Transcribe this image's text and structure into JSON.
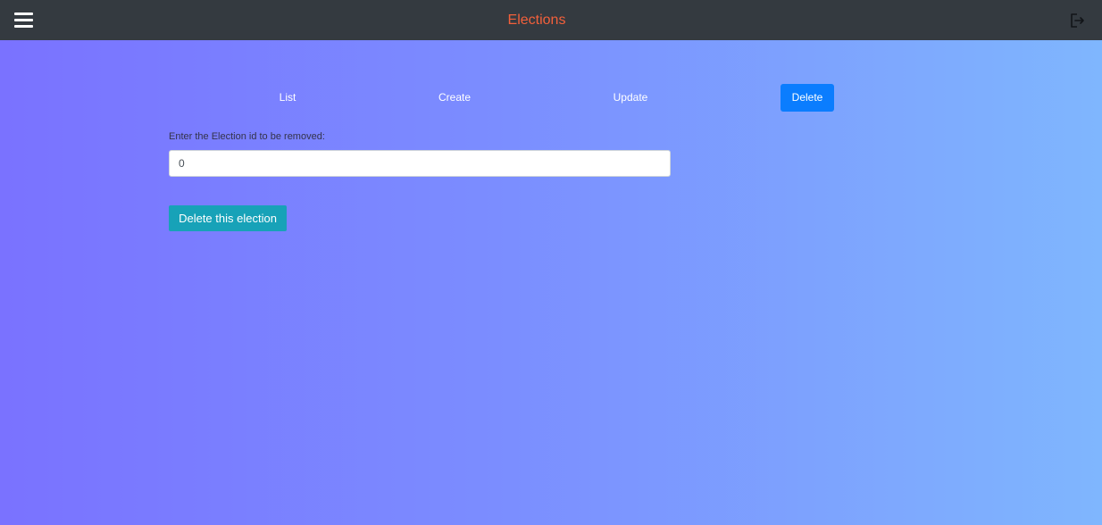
{
  "header": {
    "title": "Elections",
    "menu_icon": "hamburger-menu-icon",
    "logout_icon": "logout-icon",
    "title_color": "#f3603b"
  },
  "tabs": [
    {
      "label": "List",
      "active": false
    },
    {
      "label": "Create",
      "active": false
    },
    {
      "label": "Update",
      "active": false
    },
    {
      "label": "Delete",
      "active": true
    }
  ],
  "form": {
    "label": "Enter the Election id to be removed:",
    "value": "0",
    "submit_label": "Delete this election"
  },
  "colors": {
    "topbar": "#343a40",
    "active_tab": "#0b7dfe",
    "submit_button": "#17a2b8"
  }
}
